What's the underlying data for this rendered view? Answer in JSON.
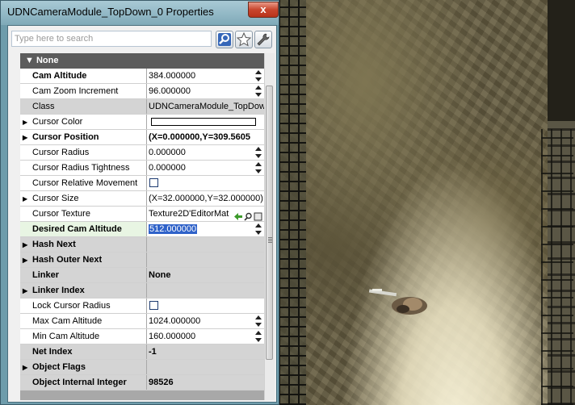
{
  "window": {
    "title": "UDNCameraModule_TopDown_0 Properties",
    "close_label": "x"
  },
  "search": {
    "placeholder": "Type here to search"
  },
  "toolbar": {
    "search_icon": "search-icon",
    "favorites_icon": "star-icon",
    "tools_icon": "wrench-icon"
  },
  "category": {
    "label": "None"
  },
  "properties": [
    {
      "name": "Cam Altitude",
      "value": "384.000000"
    },
    {
      "name": "Cam Zoom Increment",
      "value": "96.000000"
    },
    {
      "name": "Class",
      "value": "UDNCameraModule_TopDown"
    },
    {
      "name": "Cursor Color",
      "value": ""
    },
    {
      "name": "Cursor Position",
      "value": "(X=0.000000,Y=309.5605"
    },
    {
      "name": "Cursor Radius",
      "value": "0.000000"
    },
    {
      "name": "Cursor Radius Tightness",
      "value": "0.000000"
    },
    {
      "name": "Cursor Relative Movement",
      "value": ""
    },
    {
      "name": "Cursor Size",
      "value": "(X=32.000000,Y=32.000000)"
    },
    {
      "name": "Cursor Texture",
      "value": "Texture2D'EditorMat"
    },
    {
      "name": "Desired Cam Altitude",
      "value": "512.000000"
    },
    {
      "name": "Hash Next",
      "value": ""
    },
    {
      "name": "Hash Outer Next",
      "value": ""
    },
    {
      "name": "Linker",
      "value": "None"
    },
    {
      "name": "Linker Index",
      "value": ""
    },
    {
      "name": "Lock Cursor Radius",
      "value": ""
    },
    {
      "name": "Max Cam Altitude",
      "value": "1024.000000"
    },
    {
      "name": "Min Cam Altitude",
      "value": "160.000000"
    },
    {
      "name": "Net Index",
      "value": "-1"
    },
    {
      "name": "Object Flags",
      "value": ""
    },
    {
      "name": "Object Internal Integer",
      "value": "98526"
    }
  ]
}
